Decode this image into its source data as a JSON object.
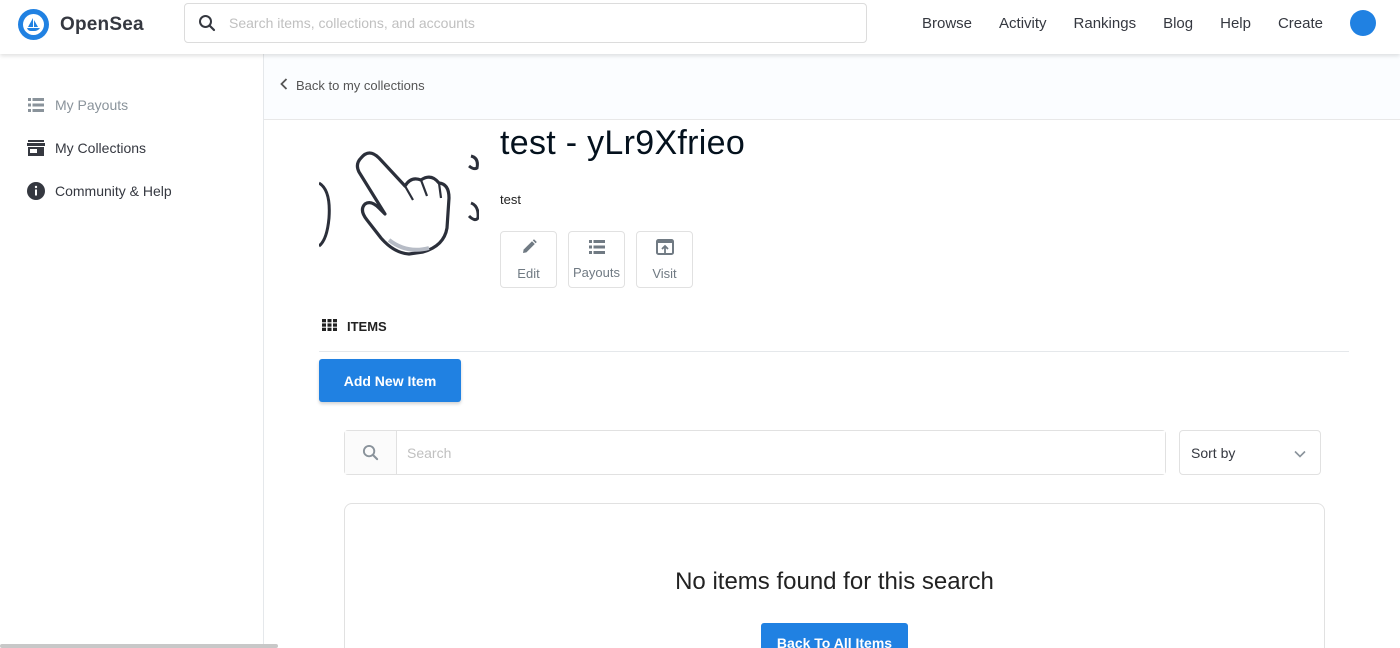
{
  "header": {
    "logo_text": "OpenSea",
    "search_placeholder": "Search items, collections, and accounts",
    "nav": [
      "Browse",
      "Activity",
      "Rankings",
      "Blog",
      "Help",
      "Create"
    ],
    "brand_color": "#2081e2"
  },
  "sidebar": {
    "items": [
      {
        "label": "My Payouts",
        "icon": "list-icon"
      },
      {
        "label": "My Collections",
        "icon": "storefront-icon"
      },
      {
        "label": "Community & Help",
        "icon": "info-icon"
      }
    ]
  },
  "breadcrumb": {
    "label": "Back to my collections"
  },
  "collection": {
    "title": "test - yLr9Xfrieo",
    "description": "test",
    "actions": [
      {
        "label": "Edit",
        "icon": "pencil-icon"
      },
      {
        "label": "Payouts",
        "icon": "list-icon"
      },
      {
        "label": "Visit",
        "icon": "open-external-icon"
      }
    ]
  },
  "items_section": {
    "heading": "ITEMS",
    "add_button": "Add New Item",
    "search_placeholder": "Search",
    "sort_label": "Sort by",
    "empty_message": "No items found for this search",
    "back_button": "Back To All Items"
  }
}
